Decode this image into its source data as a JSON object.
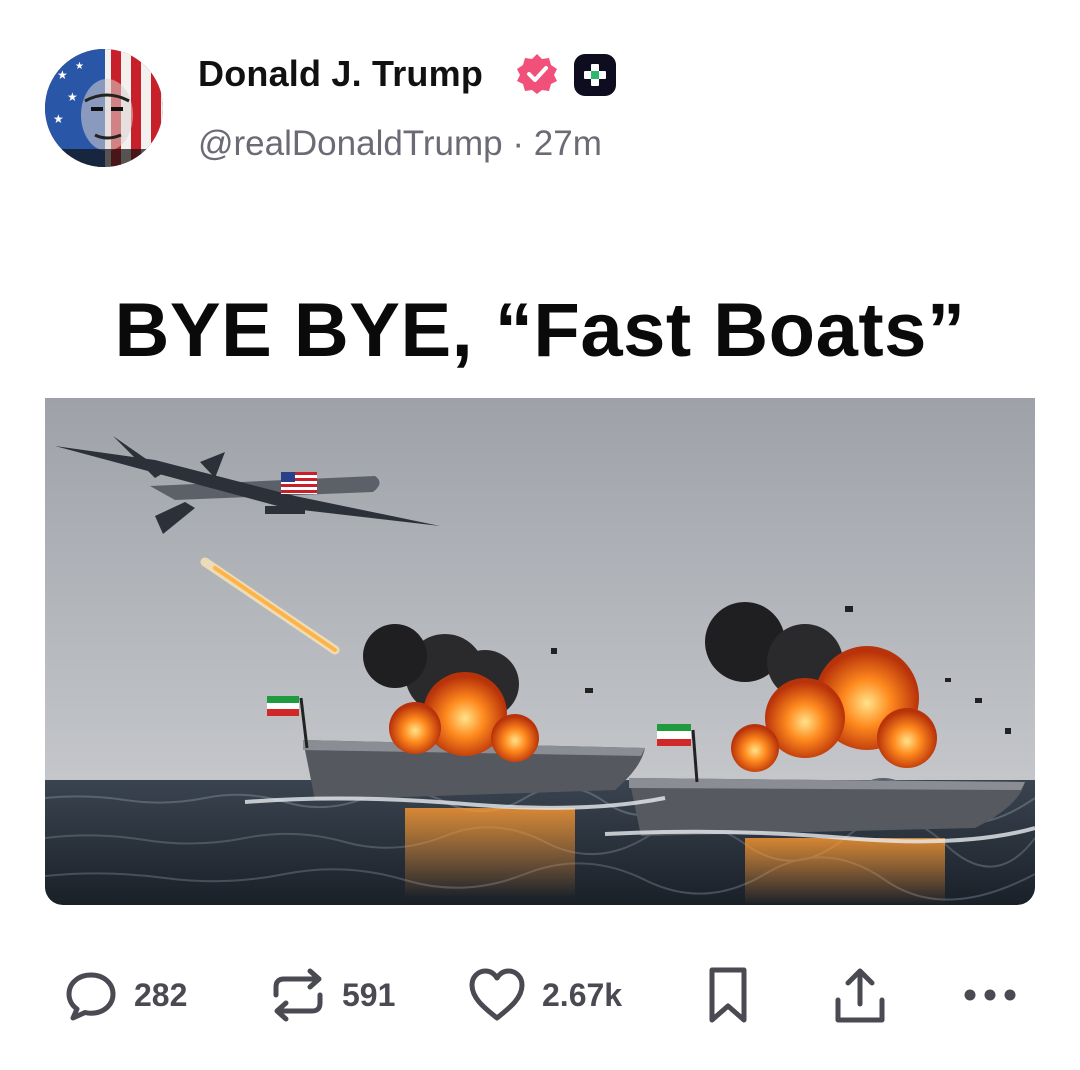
{
  "post": {
    "author_name": "Donald J. Trump",
    "handle": "@realDonaldTrump",
    "separator": "·",
    "time_ago": "27m",
    "badge_icon": "verified-badge-icon",
    "subscribe_icon": "plus-icon",
    "avatar_icon": "avatar",
    "accent_color": "#f0507a"
  },
  "media": {
    "headline": "BYE BYE, “Fast Boats”"
  },
  "actions": {
    "reply_count": "282",
    "repost_count": "591",
    "like_count": "2.67k",
    "reply_icon": "reply-icon",
    "repost_icon": "repost-icon",
    "like_icon": "heart-icon",
    "bookmark_icon": "bookmark-icon",
    "share_icon": "share-icon",
    "more_icon": "more-icon"
  }
}
